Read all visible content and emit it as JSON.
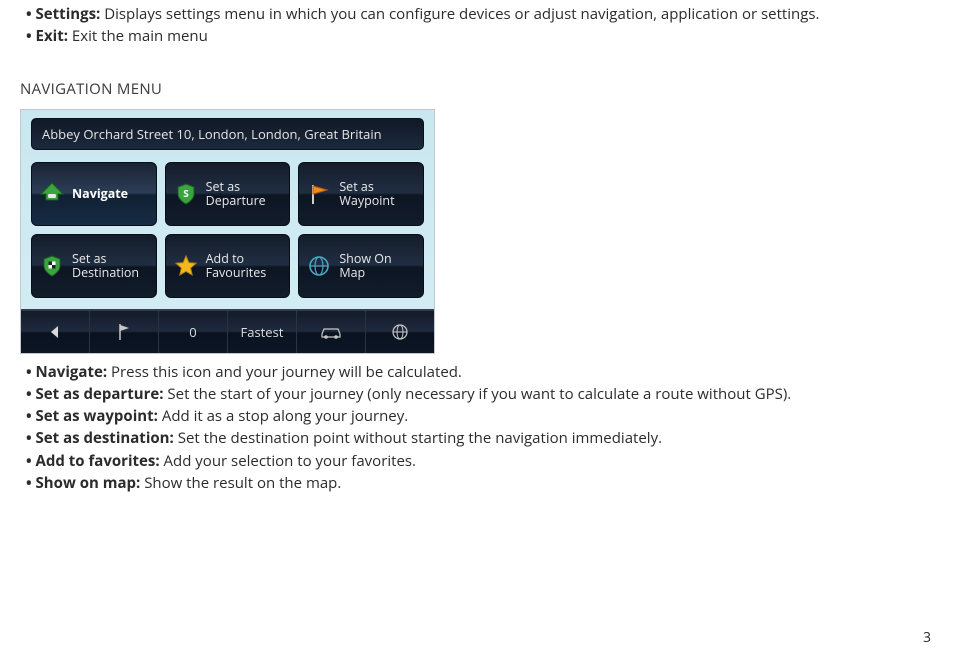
{
  "top_list": [
    {
      "term": "Settings:",
      "text": " Displays settings menu in which you can configure devices or adjust navigation, application or settings."
    },
    {
      "term": "Exit:",
      "text": " Exit the main menu"
    }
  ],
  "section_heading": "NAVIGATION MENU",
  "address_bar": "Abbey Orchard Street 10, London, London, Great Britain",
  "nav_buttons": [
    {
      "label_top": "Navigate",
      "label_bot": "",
      "active": true
    },
    {
      "label_top": "Set as",
      "label_bot": "Departure",
      "active": false
    },
    {
      "label_top": "Set as",
      "label_bot": "Waypoint",
      "active": false
    },
    {
      "label_top": "Set as",
      "label_bot": "Destination",
      "active": false
    },
    {
      "label_top": "Add to",
      "label_bot": "Favourites",
      "active": false
    },
    {
      "label_top": "Show On",
      "label_bot": "Map",
      "active": false
    }
  ],
  "bottom_bar": {
    "count": "0",
    "mode": "Fastest"
  },
  "bottom_list": [
    {
      "term": "Navigate:",
      "text": " Press this icon and your journey will be calculated."
    },
    {
      "term": "Set as departure:",
      "text": " Set the start of your journey (only necessary if you want to calculate a route without GPS)."
    },
    {
      "term": "Set as waypoint:",
      "text": " Add it as a stop along your journey."
    },
    {
      "term": "Set as destination:",
      "text": " Set the destination point without starting the navigation immediately."
    },
    {
      "term": "Add to favorites:",
      "text": " Add your selection to your favorites."
    },
    {
      "term": "Show on map:",
      "text": " Show the result on the map."
    }
  ],
  "page_number": "3"
}
